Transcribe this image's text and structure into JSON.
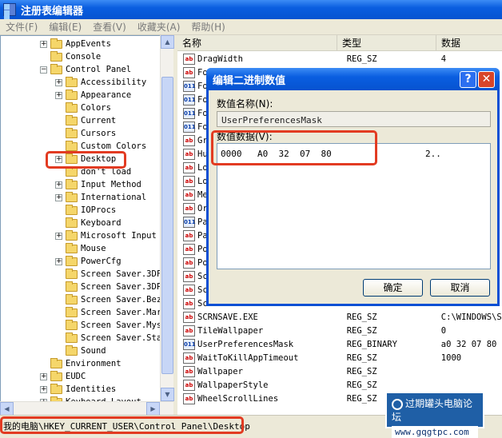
{
  "window": {
    "title": "注册表编辑器"
  },
  "menu": [
    "文件(F)",
    "编辑(E)",
    "查看(V)",
    "收藏夹(A)",
    "帮助(H)"
  ],
  "tree": [
    {
      "label": "AppEvents",
      "level": 1,
      "exp": "+"
    },
    {
      "label": "Console",
      "level": 1,
      "exp": ""
    },
    {
      "label": "Control Panel",
      "level": 1,
      "exp": "−"
    },
    {
      "label": "Accessibility",
      "level": 2,
      "exp": "+"
    },
    {
      "label": "Appearance",
      "level": 2,
      "exp": "+"
    },
    {
      "label": "Colors",
      "level": 2,
      "exp": ""
    },
    {
      "label": "Current",
      "level": 2,
      "exp": ""
    },
    {
      "label": "Cursors",
      "level": 2,
      "exp": ""
    },
    {
      "label": "Custom Colors",
      "level": 2,
      "exp": ""
    },
    {
      "label": "Desktop",
      "level": 2,
      "exp": "+"
    },
    {
      "label": "don't load",
      "level": 2,
      "exp": ""
    },
    {
      "label": "Input Method",
      "level": 2,
      "exp": "+"
    },
    {
      "label": "International",
      "level": 2,
      "exp": "+"
    },
    {
      "label": "IOProcs",
      "level": 2,
      "exp": ""
    },
    {
      "label": "Keyboard",
      "level": 2,
      "exp": ""
    },
    {
      "label": "Microsoft Input",
      "level": 2,
      "exp": "+"
    },
    {
      "label": "Mouse",
      "level": 2,
      "exp": ""
    },
    {
      "label": "PowerCfg",
      "level": 2,
      "exp": "+"
    },
    {
      "label": "Screen Saver.3DF",
      "level": 2,
      "exp": ""
    },
    {
      "label": "Screen Saver.3DP",
      "level": 2,
      "exp": ""
    },
    {
      "label": "Screen Saver.Bez",
      "level": 2,
      "exp": ""
    },
    {
      "label": "Screen Saver.Mar",
      "level": 2,
      "exp": ""
    },
    {
      "label": "Screen Saver.Mys",
      "level": 2,
      "exp": ""
    },
    {
      "label": "Screen Saver.Sta",
      "level": 2,
      "exp": ""
    },
    {
      "label": "Sound",
      "level": 2,
      "exp": ""
    },
    {
      "label": "Environment",
      "level": 1,
      "exp": ""
    },
    {
      "label": "EUDC",
      "level": 1,
      "exp": "+"
    },
    {
      "label": "Identities",
      "level": 1,
      "exp": "+"
    },
    {
      "label": "Keyboard Layout",
      "level": 1,
      "exp": "+"
    }
  ],
  "list": {
    "headers": {
      "name": "名称",
      "type": "类型",
      "data": "数据"
    },
    "rows": [
      {
        "name": "DragWidth",
        "type": "REG_SZ",
        "data": "4",
        "icon": "ab"
      },
      {
        "name": "Fo",
        "type": "",
        "data": "",
        "icon": "ab"
      },
      {
        "name": "Fo",
        "type": "",
        "data": "",
        "icon": "bin"
      },
      {
        "name": "Fo",
        "type": "",
        "data": "",
        "icon": "bin"
      },
      {
        "name": "Fo",
        "type": "",
        "data": "",
        "icon": "bin"
      },
      {
        "name": "Fo",
        "type": "",
        "data": "",
        "icon": "bin"
      },
      {
        "name": "Gr",
        "type": "",
        "data": "",
        "icon": "ab"
      },
      {
        "name": "Hu",
        "type": "",
        "data": "",
        "icon": "ab"
      },
      {
        "name": "Lo",
        "type": "",
        "data": "",
        "icon": "ab"
      },
      {
        "name": "Lo",
        "type": "",
        "data": "",
        "icon": "ab"
      },
      {
        "name": "Me",
        "type": "",
        "data": "",
        "icon": "ab"
      },
      {
        "name": "Or",
        "type": "",
        "data": "",
        "icon": "ab"
      },
      {
        "name": "Pa",
        "type": "",
        "data": "",
        "icon": "bin"
      },
      {
        "name": "Pa",
        "type": "",
        "data": "",
        "icon": "ab"
      },
      {
        "name": "Po",
        "type": "",
        "data": "",
        "icon": "ab"
      },
      {
        "name": "Po",
        "type": "",
        "data": "",
        "icon": "ab"
      },
      {
        "name": "Sc",
        "type": "",
        "data": "",
        "icon": "ab"
      },
      {
        "name": "Sc",
        "type": "",
        "data": "",
        "icon": "ab"
      },
      {
        "name": "Sc",
        "type": "",
        "data": "",
        "icon": "ab"
      },
      {
        "name": "SCRNSAVE.EXE",
        "type": "REG_SZ",
        "data": "C:\\WINDOWS\\Sys",
        "icon": "ab"
      },
      {
        "name": "TileWallpaper",
        "type": "REG_SZ",
        "data": "0",
        "icon": "ab"
      },
      {
        "name": "UserPreferencesMask",
        "type": "REG_BINARY",
        "data": "a0 32 07 80",
        "icon": "bin"
      },
      {
        "name": "WaitToKillAppTimeout",
        "type": "REG_SZ",
        "data": "1000",
        "icon": "ab"
      },
      {
        "name": "Wallpaper",
        "type": "REG_SZ",
        "data": "",
        "icon": "ab"
      },
      {
        "name": "WallpaperStyle",
        "type": "REG_SZ",
        "data": "",
        "icon": "ab"
      },
      {
        "name": "WheelScrollLines",
        "type": "REG_SZ",
        "data": "",
        "icon": "ab"
      }
    ]
  },
  "dialog": {
    "title": "编辑二进制数值",
    "name_label": "数值名称(N):",
    "name_value": "UserPreferencesMask",
    "data_label": "数值数据(V):",
    "hex_offset": "0000",
    "hex_bytes": "A0  32  07  80",
    "hex_ascii": "2..",
    "ok_label": "确定",
    "cancel_label": "取消",
    "help_glyph": "?",
    "close_glyph": "✕"
  },
  "status": {
    "path": "我的电脑\\HKEY_CURRENT_USER\\Control Panel\\Desktop"
  },
  "watermark": {
    "line1": "过期罐头电脑论坛",
    "line2": "www.gqgtpc.com"
  }
}
